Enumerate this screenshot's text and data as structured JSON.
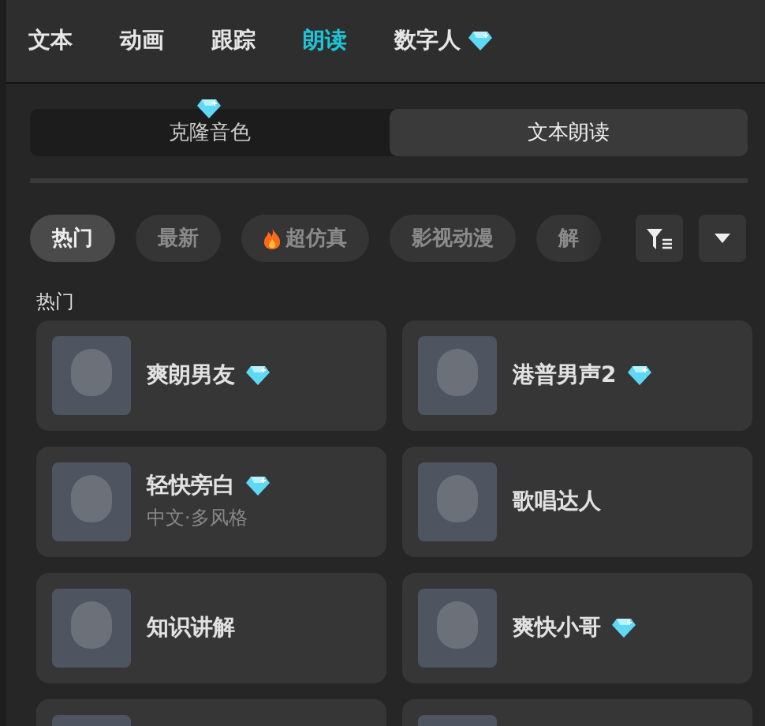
{
  "tabs": [
    {
      "label": "文本",
      "selected": false,
      "premium": false
    },
    {
      "label": "动画",
      "selected": false,
      "premium": false
    },
    {
      "label": "跟踪",
      "selected": false,
      "premium": false
    },
    {
      "label": "朗读",
      "selected": true,
      "premium": false
    },
    {
      "label": "数字人",
      "selected": false,
      "premium": true
    }
  ],
  "segments": [
    {
      "label": "克隆音色",
      "selected": false,
      "premium": true
    },
    {
      "label": "文本朗读",
      "selected": true,
      "premium": false
    }
  ],
  "categories": [
    {
      "label": "热门",
      "selected": true,
      "hot": false
    },
    {
      "label": "最新",
      "selected": false,
      "hot": false
    },
    {
      "label": "超仿真",
      "selected": false,
      "hot": true
    },
    {
      "label": "影视动漫",
      "selected": false,
      "hot": false
    },
    {
      "label": "解",
      "selected": false,
      "hot": false
    }
  ],
  "section_title": "热门",
  "voices": [
    {
      "name": "爽朗男友",
      "premium": true
    },
    {
      "name": "港普男声2",
      "premium": true
    },
    {
      "name": "轻快旁白",
      "premium": true,
      "subtitle": "中文·多风格"
    },
    {
      "name": "歌唱达人",
      "premium": false
    },
    {
      "name": "知识讲解",
      "premium": false
    },
    {
      "name": "爽快小哥",
      "premium": true
    }
  ]
}
